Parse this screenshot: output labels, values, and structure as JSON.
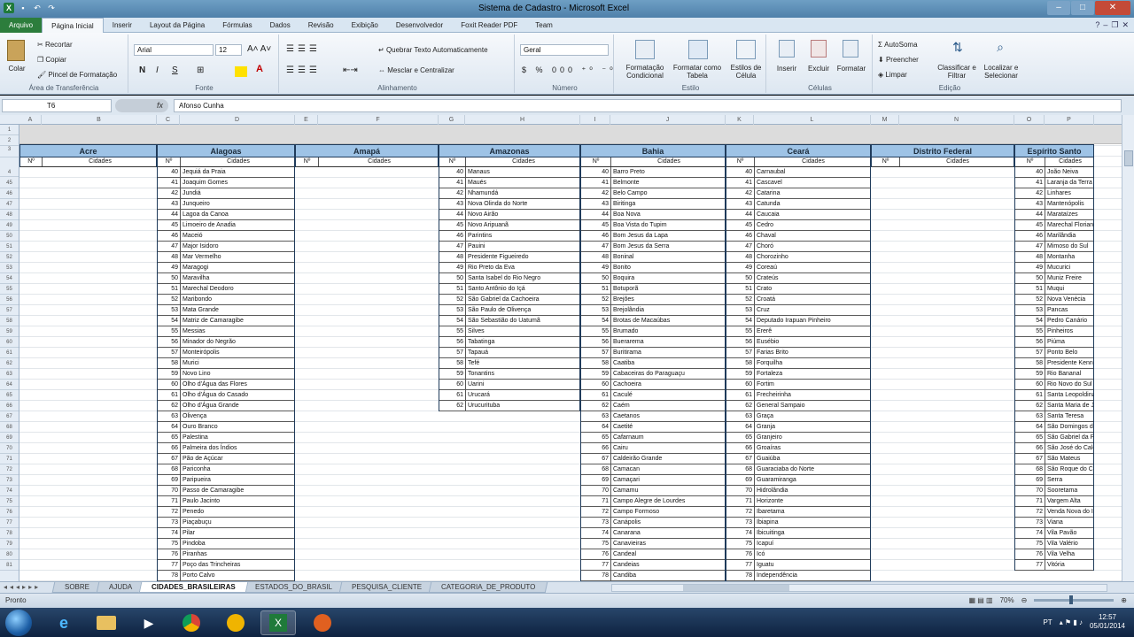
{
  "window": {
    "title": "Sistema de Cadastro - Microsoft Excel",
    "minimize": "–",
    "maximize": "□",
    "close": "✕"
  },
  "ribbon_tabs": [
    "Arquivo",
    "Página Inicial",
    "Inserir",
    "Layout da Página",
    "Fórmulas",
    "Dados",
    "Revisão",
    "Exibição",
    "Desenvolvedor",
    "Foxit Reader PDF",
    "Team"
  ],
  "ribbon": {
    "clipboard": {
      "paste": "Colar",
      "cut": "Recortar",
      "copy": "Copiar",
      "format_painter": "Pincel de Formatação",
      "label": "Área de Transferência"
    },
    "font": {
      "name": "Arial",
      "size": "12",
      "bold": "N",
      "italic": "I",
      "underline": "S",
      "label": "Fonte"
    },
    "alignment": {
      "wrap": "Quebrar Texto Automaticamente",
      "merge": "Mesclar e Centralizar",
      "label": "Alinhamento"
    },
    "number": {
      "format": "Geral",
      "label": "Número"
    },
    "styles": {
      "conditional": "Formatação Condicional",
      "as_table": "Formatar como Tabela",
      "cell_styles": "Estilos de Célula",
      "label": "Estilo"
    },
    "cells": {
      "insert": "Inserir",
      "delete": "Excluir",
      "format": "Formatar",
      "label": "Células"
    },
    "editing": {
      "autosum": "AutoSoma",
      "fill": "Preencher",
      "clear": "Limpar",
      "sort": "Classificar e Filtrar",
      "find": "Localizar e Selecionar",
      "label": "Edição"
    }
  },
  "formula_bar": {
    "name_box": "T6",
    "fx": "fx",
    "value": "Afonso Cunha"
  },
  "columns": [
    "A",
    "B",
    "C",
    "D",
    "E",
    "F",
    "G",
    "H",
    "I",
    "J",
    "K",
    "L",
    "M",
    "N",
    "O",
    "P"
  ],
  "row_numbers": [
    "1",
    "2",
    "3",
    "4",
    "45",
    "46",
    "47",
    "48",
    "49",
    "50",
    "51",
    "52",
    "53",
    "54",
    "55",
    "56",
    "57",
    "58",
    "59",
    "60",
    "61",
    "62",
    "63",
    "64",
    "65",
    "66",
    "67",
    "68",
    "69",
    "70",
    "71",
    "72",
    "73",
    "74",
    "75",
    "76",
    "77",
    "78",
    "79",
    "80",
    "81"
  ],
  "num_header": "Nº",
  "cities_header": "Cidades",
  "states": [
    {
      "name": "Acre",
      "rows": []
    },
    {
      "name": "Alagoas",
      "rows": [
        [
          "40",
          "Jequiá da Praia"
        ],
        [
          "41",
          "Joaquim Gomes"
        ],
        [
          "42",
          "Jundiá"
        ],
        [
          "43",
          "Junqueiro"
        ],
        [
          "44",
          "Lagoa da Canoa"
        ],
        [
          "45",
          "Limoeiro de Anadia"
        ],
        [
          "46",
          "Maceió"
        ],
        [
          "47",
          "Major Isidoro"
        ],
        [
          "48",
          "Mar Vermelho"
        ],
        [
          "49",
          "Maragogi"
        ],
        [
          "50",
          "Maravilha"
        ],
        [
          "51",
          "Marechal Deodoro"
        ],
        [
          "52",
          "Maribondo"
        ],
        [
          "53",
          "Mata Grande"
        ],
        [
          "54",
          "Matriz de Camaragibe"
        ],
        [
          "55",
          "Messias"
        ],
        [
          "56",
          "Minador do Negrão"
        ],
        [
          "57",
          "Monteirópolis"
        ],
        [
          "58",
          "Murici"
        ],
        [
          "59",
          "Novo Lino"
        ],
        [
          "60",
          "Olho d'Água das Flores"
        ],
        [
          "61",
          "Olho d'Água do Casado"
        ],
        [
          "62",
          "Olho d'Água Grande"
        ],
        [
          "63",
          "Olivença"
        ],
        [
          "64",
          "Ouro Branco"
        ],
        [
          "65",
          "Palestina"
        ],
        [
          "66",
          "Palmeira dos Índios"
        ],
        [
          "67",
          "Pão de Açúcar"
        ],
        [
          "68",
          "Pariconha"
        ],
        [
          "69",
          "Paripueira"
        ],
        [
          "70",
          "Passo de Camaragibe"
        ],
        [
          "71",
          "Paulo Jacinto"
        ],
        [
          "72",
          "Penedo"
        ],
        [
          "73",
          "Piaçabuçu"
        ],
        [
          "74",
          "Pilar"
        ],
        [
          "75",
          "Pindoba"
        ],
        [
          "76",
          "Piranhas"
        ],
        [
          "77",
          "Poço das Trincheiras"
        ],
        [
          "78",
          "Porto Calvo"
        ]
      ]
    },
    {
      "name": "Amapá",
      "rows": []
    },
    {
      "name": "Amazonas",
      "rows": [
        [
          "40",
          "Manaus"
        ],
        [
          "41",
          "Maués"
        ],
        [
          "42",
          "Nhamundá"
        ],
        [
          "43",
          "Nova Olinda do Norte"
        ],
        [
          "44",
          "Novo Airão"
        ],
        [
          "45",
          "Novo Aripuanã"
        ],
        [
          "46",
          "Parintins"
        ],
        [
          "47",
          "Pauini"
        ],
        [
          "48",
          "Presidente Figueiredo"
        ],
        [
          "49",
          "Rio Preto da Eva"
        ],
        [
          "50",
          "Santa Isabel do Rio Negro"
        ],
        [
          "51",
          "Santo Antônio do Içá"
        ],
        [
          "52",
          "São Gabriel da Cachoeira"
        ],
        [
          "53",
          "São Paulo de Olivença"
        ],
        [
          "54",
          "São Sebastião do Uatumã"
        ],
        [
          "55",
          "Silves"
        ],
        [
          "56",
          "Tabatinga"
        ],
        [
          "57",
          "Tapauá"
        ],
        [
          "58",
          "Tefé"
        ],
        [
          "59",
          "Tonantins"
        ],
        [
          "60",
          "Uarini"
        ],
        [
          "61",
          "Urucará"
        ],
        [
          "62",
          "Urucurituba"
        ]
      ]
    },
    {
      "name": "Bahia",
      "rows": [
        [
          "40",
          "Barro Preto"
        ],
        [
          "41",
          "Belmonte"
        ],
        [
          "42",
          "Belo Campo"
        ],
        [
          "43",
          "Biritinga"
        ],
        [
          "44",
          "Boa Nova"
        ],
        [
          "45",
          "Boa Vista do Tupim"
        ],
        [
          "46",
          "Bom Jesus da Lapa"
        ],
        [
          "47",
          "Bom Jesus da Serra"
        ],
        [
          "48",
          "Boninal"
        ],
        [
          "49",
          "Bonito"
        ],
        [
          "50",
          "Boquira"
        ],
        [
          "51",
          "Botuporã"
        ],
        [
          "52",
          "Brejões"
        ],
        [
          "53",
          "Brejolândia"
        ],
        [
          "54",
          "Brotas de Macaúbas"
        ],
        [
          "55",
          "Brumado"
        ],
        [
          "56",
          "Buerarema"
        ],
        [
          "57",
          "Buritirama"
        ],
        [
          "58",
          "Caatiba"
        ],
        [
          "59",
          "Cabaceiras do Paraguaçu"
        ],
        [
          "60",
          "Cachoeira"
        ],
        [
          "61",
          "Caculé"
        ],
        [
          "62",
          "Caém"
        ],
        [
          "63",
          "Caetanos"
        ],
        [
          "64",
          "Caetité"
        ],
        [
          "65",
          "Cafarnaum"
        ],
        [
          "66",
          "Cairu"
        ],
        [
          "67",
          "Caldeirão Grande"
        ],
        [
          "68",
          "Camacan"
        ],
        [
          "69",
          "Camaçari"
        ],
        [
          "70",
          "Camamu"
        ],
        [
          "71",
          "Campo Alegre de Lourdes"
        ],
        [
          "72",
          "Campo Formoso"
        ],
        [
          "73",
          "Canápolis"
        ],
        [
          "74",
          "Canarana"
        ],
        [
          "75",
          "Canavieiras"
        ],
        [
          "76",
          "Candeal"
        ],
        [
          "77",
          "Candeias"
        ],
        [
          "78",
          "Candiba"
        ]
      ]
    },
    {
      "name": "Ceará",
      "rows": [
        [
          "40",
          "Carnaubal"
        ],
        [
          "41",
          "Cascavel"
        ],
        [
          "42",
          "Catarina"
        ],
        [
          "43",
          "Catunda"
        ],
        [
          "44",
          "Caucaia"
        ],
        [
          "45",
          "Cedro"
        ],
        [
          "46",
          "Chaval"
        ],
        [
          "47",
          "Choró"
        ],
        [
          "48",
          "Chorozinho"
        ],
        [
          "49",
          "Coreaú"
        ],
        [
          "50",
          "Crateús"
        ],
        [
          "51",
          "Crato"
        ],
        [
          "52",
          "Croatá"
        ],
        [
          "53",
          "Cruz"
        ],
        [
          "54",
          "Deputado Irapuan Pinheiro"
        ],
        [
          "55",
          "Ererê"
        ],
        [
          "56",
          "Eusébio"
        ],
        [
          "57",
          "Farias Brito"
        ],
        [
          "58",
          "Forquilha"
        ],
        [
          "59",
          "Fortaleza"
        ],
        [
          "60",
          "Fortim"
        ],
        [
          "61",
          "Frecheirinha"
        ],
        [
          "62",
          "General Sampaio"
        ],
        [
          "63",
          "Graça"
        ],
        [
          "64",
          "Granja"
        ],
        [
          "65",
          "Granjeiro"
        ],
        [
          "66",
          "Groaíras"
        ],
        [
          "67",
          "Guaiúba"
        ],
        [
          "68",
          "Guaraciaba do Norte"
        ],
        [
          "69",
          "Guaramiranga"
        ],
        [
          "70",
          "Hidrolândia"
        ],
        [
          "71",
          "Horizonte"
        ],
        [
          "72",
          "Ibaretama"
        ],
        [
          "73",
          "Ibiapina"
        ],
        [
          "74",
          "Ibicuitinga"
        ],
        [
          "75",
          "Icapuí"
        ],
        [
          "76",
          "Icó"
        ],
        [
          "77",
          "Iguatu"
        ],
        [
          "78",
          "Independência"
        ]
      ]
    },
    {
      "name": "Distrito Federal",
      "rows": []
    },
    {
      "name": "Espírito Santo",
      "rows": [
        [
          "40",
          "João Neiva"
        ],
        [
          "41",
          "Laranja da Terra"
        ],
        [
          "42",
          "Linhares"
        ],
        [
          "43",
          "Mantenópolis"
        ],
        [
          "44",
          "Marataízes"
        ],
        [
          "45",
          "Marechal Floriano"
        ],
        [
          "46",
          "Marilândia"
        ],
        [
          "47",
          "Mimoso do Sul"
        ],
        [
          "48",
          "Montanha"
        ],
        [
          "49",
          "Mucurici"
        ],
        [
          "50",
          "Muniz Freire"
        ],
        [
          "51",
          "Muqui"
        ],
        [
          "52",
          "Nova Venécia"
        ],
        [
          "53",
          "Pancas"
        ],
        [
          "54",
          "Pedro Canário"
        ],
        [
          "55",
          "Pinheiros"
        ],
        [
          "56",
          "Piúma"
        ],
        [
          "57",
          "Ponto Belo"
        ],
        [
          "58",
          "Presidente Kennedy"
        ],
        [
          "59",
          "Rio Bananal"
        ],
        [
          "60",
          "Rio Novo do Sul"
        ],
        [
          "61",
          "Santa Leopoldina"
        ],
        [
          "62",
          "Santa Maria de Jetibá"
        ],
        [
          "63",
          "Santa Teresa"
        ],
        [
          "64",
          "São Domingos do Norte"
        ],
        [
          "65",
          "São Gabriel da Palha"
        ],
        [
          "66",
          "São José do Calçado"
        ],
        [
          "67",
          "São Mateus"
        ],
        [
          "68",
          "São Roque do Canaã"
        ],
        [
          "69",
          "Serra"
        ],
        [
          "70",
          "Sooretama"
        ],
        [
          "71",
          "Vargem Alta"
        ],
        [
          "72",
          "Venda Nova do Imigrante"
        ],
        [
          "73",
          "Viana"
        ],
        [
          "74",
          "Vila Pavão"
        ],
        [
          "75",
          "Vila Valério"
        ],
        [
          "76",
          "Vila Velha"
        ],
        [
          "77",
          "Vitória"
        ]
      ]
    }
  ],
  "sheet_tabs": [
    "SOBRE",
    "AJUDA",
    "CIDADES_BRASILEIRAS",
    "ESTADOS_DO_BRASIL",
    "PESQUISA_CLIENTE",
    "CATEGORIA_DE_PRODUTO"
  ],
  "active_sheet": "CIDADES_BRASILEIRAS",
  "status": {
    "ready": "Pronto",
    "zoom": "70%"
  },
  "taskbar": {
    "lang": "PT",
    "time": "12:57",
    "date": "05/01/2014"
  }
}
